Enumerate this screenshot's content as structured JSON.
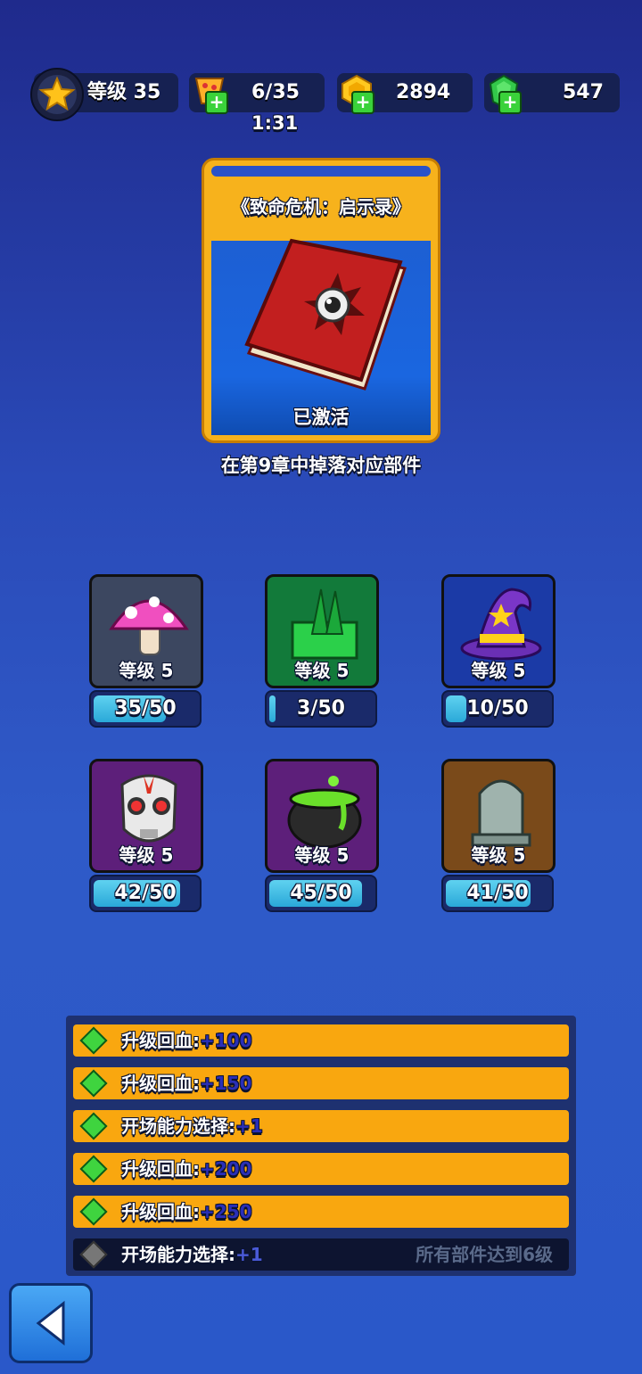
{
  "header": {
    "level_label": "等级 35",
    "tickets": "6/35",
    "ticket_timer": "1:31",
    "coins": "2894",
    "gems": "547"
  },
  "book": {
    "title": "《致命危机：启示录》",
    "status": "已激活",
    "hint": "在第9章中掉落对应部件"
  },
  "parts": [
    {
      "name": "mushroom",
      "level": "等级 5",
      "progress": "35/50",
      "fraction": 0.7,
      "tile_color": "#3c4760"
    },
    {
      "name": "spikes",
      "level": "等级 5",
      "progress": "3/50",
      "fraction": 0.06,
      "tile_color": "#127a3a"
    },
    {
      "name": "wizard-hat",
      "level": "等级 5",
      "progress": "10/50",
      "fraction": 0.2,
      "tile_color": "#1b3aa6"
    },
    {
      "name": "hockey-mask",
      "level": "等级 5",
      "progress": "42/50",
      "fraction": 0.84,
      "tile_color": "#5d1f7a"
    },
    {
      "name": "cauldron",
      "level": "等级 5",
      "progress": "45/50",
      "fraction": 0.9,
      "tile_color": "#5d1f7a"
    },
    {
      "name": "tombstone",
      "level": "等级 5",
      "progress": "41/50",
      "fraction": 0.82,
      "tile_color": "#7a4a1a"
    }
  ],
  "rewards": [
    {
      "label": "升级回血:",
      "value": "+100",
      "locked": false,
      "requirement": ""
    },
    {
      "label": "升级回血:",
      "value": "+150",
      "locked": false,
      "requirement": ""
    },
    {
      "label": "开场能力选择:",
      "value": "+1",
      "locked": false,
      "requirement": ""
    },
    {
      "label": "升级回血:",
      "value": "+200",
      "locked": false,
      "requirement": ""
    },
    {
      "label": "升级回血:",
      "value": "+250",
      "locked": false,
      "requirement": ""
    },
    {
      "label": "开场能力选择:",
      "value": "+1",
      "locked": true,
      "requirement": "所有部件达到6级"
    }
  ]
}
